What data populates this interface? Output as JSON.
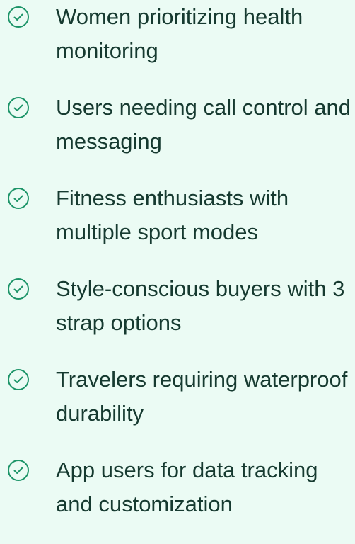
{
  "accent_color": "#1c9468",
  "text_color": "#163a30",
  "background_color": "#ebfbf4",
  "features": [
    {
      "icon": "check-circle-icon",
      "text": "Women prioritizing health monitoring"
    },
    {
      "icon": "check-circle-icon",
      "text": "Users needing call control and messaging"
    },
    {
      "icon": "check-circle-icon",
      "text": "Fitness enthusiasts with multiple sport modes"
    },
    {
      "icon": "check-circle-icon",
      "text": "Style-conscious buyers with 3 strap options"
    },
    {
      "icon": "check-circle-icon",
      "text": "Travelers requiring waterproof durability"
    },
    {
      "icon": "check-circle-icon",
      "text": "App users for data tracking and customization"
    }
  ]
}
